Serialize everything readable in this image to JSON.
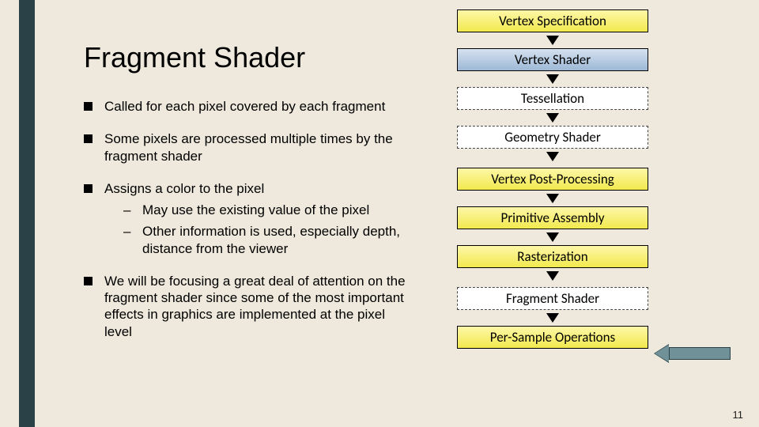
{
  "title": "Fragment Shader",
  "bullets": [
    {
      "text": "Called for each pixel covered by each fragment"
    },
    {
      "text": "Some pixels are processed multiple times by the fragment shader"
    },
    {
      "text": "Assigns a color to the pixel",
      "sub": [
        "May use the existing value of the pixel",
        "Other information is used, especially depth, distance from the viewer"
      ]
    },
    {
      "text": "We will be focusing a great deal of attention on the fragment shader since some of the most important effects in graphics are implemented at the pixel level"
    }
  ],
  "pipeline": [
    {
      "label": "Vertex Specification",
      "style": "yellow"
    },
    {
      "label": "Vertex Shader",
      "style": "blue"
    },
    {
      "label": "Tessellation",
      "style": "dashed"
    },
    {
      "label": "Geometry Shader",
      "style": "dashed"
    },
    {
      "label": "Vertex Post-Processing",
      "style": "yellow"
    },
    {
      "label": "Primitive Assembly",
      "style": "yellow"
    },
    {
      "label": "Rasterization",
      "style": "yellow"
    },
    {
      "label": "Fragment Shader",
      "style": "dashed"
    },
    {
      "label": "Per-Sample Operations",
      "style": "yellow"
    }
  ],
  "page_number": "11"
}
